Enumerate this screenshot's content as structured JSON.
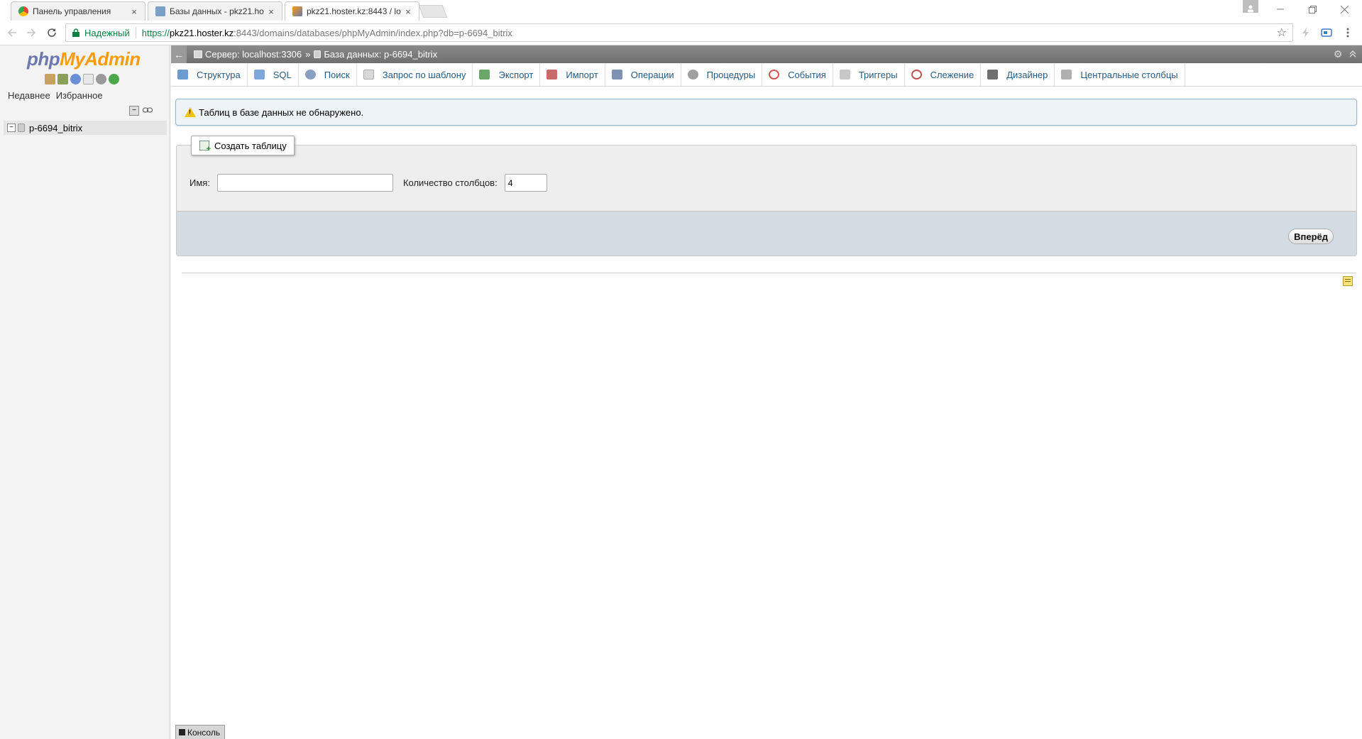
{
  "browser": {
    "tabs": [
      {
        "title": "Панель управления",
        "active": false
      },
      {
        "title": "Базы данных - pkz21.ho",
        "active": false
      },
      {
        "title": "pkz21.hoster.kz:8443 / lo",
        "active": true
      }
    ],
    "close_glyph": "×",
    "omnibox": {
      "secure_label": "Надежный",
      "url_proto": "https://",
      "url_host": "pkz21.hoster.kz",
      "url_path": ":8443/domains/databases/phpMyAdmin/index.php?db=p-6694_bitrix"
    }
  },
  "nav": {
    "logo_php": "php",
    "logo_myadmin": "MyAdmin",
    "tabs": {
      "recent": "Недавнее",
      "favorites": "Избранное"
    },
    "database": "p-6694_bitrix"
  },
  "main": {
    "breadcrumb": {
      "server": "Сервер: localhost:3306",
      "separator": "»",
      "database": "База данных: p-6694_bitrix"
    },
    "menu": [
      {
        "label": "Структура",
        "icon": "structure-icon",
        "color": "#6b9bd1"
      },
      {
        "label": "SQL",
        "icon": "sql-icon",
        "color": "#7fa8d8"
      },
      {
        "label": "Поиск",
        "icon": "search-icon",
        "color": "#8aa0c0"
      },
      {
        "label": "Запрос по шаблону",
        "icon": "query-icon",
        "color": "#b8b8b8"
      },
      {
        "label": "Экспорт",
        "icon": "export-icon",
        "color": "#6aa86a"
      },
      {
        "label": "Импорт",
        "icon": "import-icon",
        "color": "#c96a6a"
      },
      {
        "label": "Операции",
        "icon": "wrench-icon",
        "color": "#7d93b3"
      },
      {
        "label": "Процедуры",
        "icon": "routines-icon",
        "color": "#a0a0a0"
      },
      {
        "label": "События",
        "icon": "clock-icon",
        "color": "#d9534f"
      },
      {
        "label": "Триггеры",
        "icon": "triggers-icon",
        "color": "#a8a8a8"
      },
      {
        "label": "Слежение",
        "icon": "eye-icon",
        "color": "#c05050"
      },
      {
        "label": "Дизайнер",
        "icon": "designer-icon",
        "color": "#707070"
      },
      {
        "label": "Центральные столбцы",
        "icon": "columns-icon",
        "color": "#9a9a9a"
      }
    ],
    "notice": "Таблиц в базе данных не обнаружено.",
    "create_table": {
      "legend": "Создать таблицу",
      "name_label": "Имя:",
      "name_value": "",
      "cols_label": "Количество столбцов:",
      "cols_value": "4",
      "go_button": "Вперёд"
    },
    "console": "Консоль"
  },
  "colors": {
    "accent_link": "#235a81",
    "topbar": "#7a7a7a",
    "notice_bg": "#eef3f8",
    "footer_bg": "#d3dce3"
  }
}
